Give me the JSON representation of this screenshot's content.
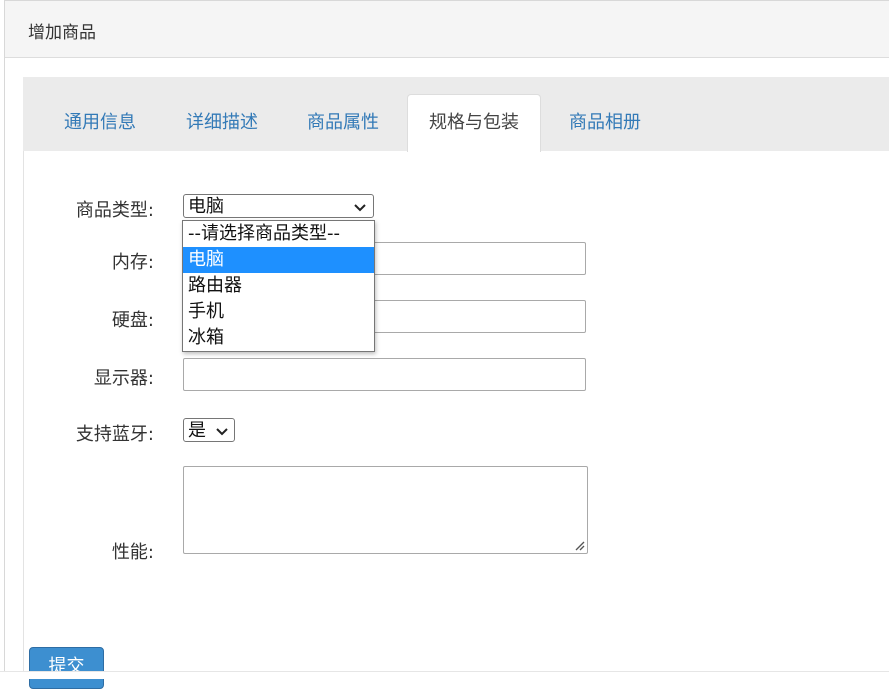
{
  "panel": {
    "title": "增加商品"
  },
  "tabs": [
    {
      "label": "通用信息",
      "active": false
    },
    {
      "label": "详细描述",
      "active": false
    },
    {
      "label": "商品属性",
      "active": false
    },
    {
      "label": "规格与包装",
      "active": true
    },
    {
      "label": "商品相册",
      "active": false
    }
  ],
  "form": {
    "type_label": "商品类型:",
    "type_value": "电脑",
    "type_options": [
      "--请选择商品类型--",
      "电脑",
      "路由器",
      "手机",
      "冰箱"
    ],
    "memory_label": "内存:",
    "memory_value": "",
    "disk_label": "硬盘:",
    "disk_value": "",
    "display_label": "显示器:",
    "display_value": "",
    "bluetooth_label": "支持蓝牙:",
    "bluetooth_value": "是",
    "performance_label": "性能:",
    "performance_value": "",
    "submit_label": "提交"
  },
  "colors": {
    "tab_link": "#337ab7",
    "selected_option": "#1e90ff",
    "submit_bg": "#3d8fd0"
  }
}
